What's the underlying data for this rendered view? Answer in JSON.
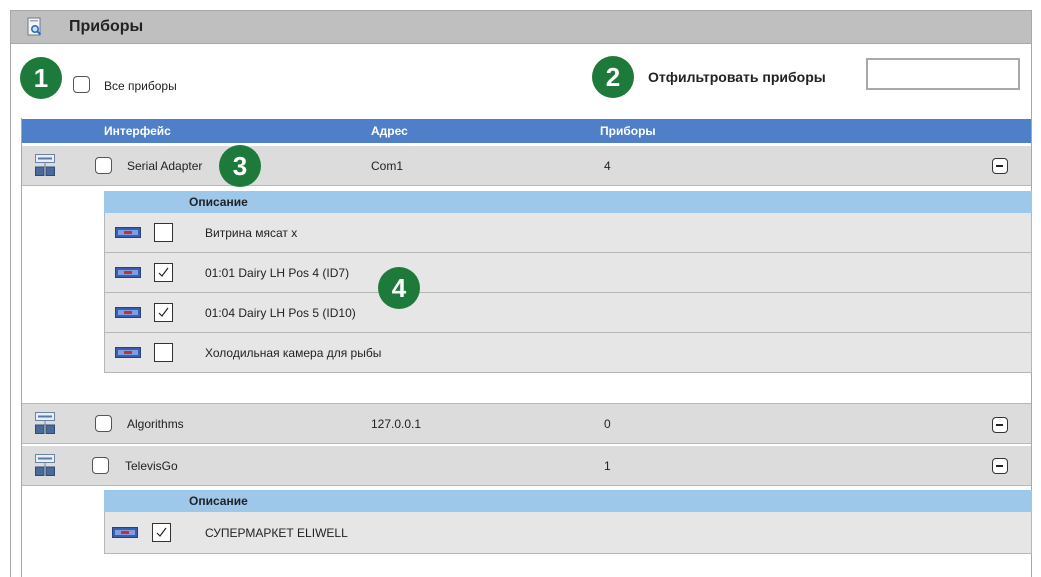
{
  "window": {
    "title": "Приборы",
    "icon": "document-search-icon"
  },
  "badges": [
    "1",
    "2",
    "3",
    "4"
  ],
  "all_devices": {
    "label": "Все приборы",
    "checked": false
  },
  "filter": {
    "label": "Отфильтровать приборы",
    "value": "",
    "placeholder": ""
  },
  "table": {
    "columns": [
      "Интерфейс",
      "Адрес",
      "Приборы"
    ],
    "description_header": "Описание",
    "interfaces": [
      {
        "name": "Serial Adapter",
        "address": "Com1",
        "count": "4",
        "checked": false,
        "expanded": true,
        "devices": [
          {
            "name": "Витрина мясат х",
            "checked": false
          },
          {
            "name": "01:01 Dairy LH Pos 4 (ID7)",
            "checked": true
          },
          {
            "name": "01:04 Dairy LH Pos 5 (ID10)",
            "checked": true
          },
          {
            "name": "Холодильная камера для рыбы",
            "checked": false
          }
        ]
      },
      {
        "name": "Algorithms",
        "address": "127.0.0.1",
        "count": "0",
        "checked": false,
        "expanded": false,
        "devices": []
      },
      {
        "name": "TelevisGo",
        "address": "",
        "count": "1",
        "checked": false,
        "expanded": true,
        "devices": [
          {
            "name": "СУПЕРМАРКЕТ ELIWELL",
            "checked": true
          }
        ]
      }
    ]
  },
  "colors": {
    "header": "#4f7fc8",
    "subheader": "#9ec8ea",
    "badge": "#1e7a3a",
    "row": "#dcdcdc",
    "titlebar": "#bfbfbf"
  }
}
